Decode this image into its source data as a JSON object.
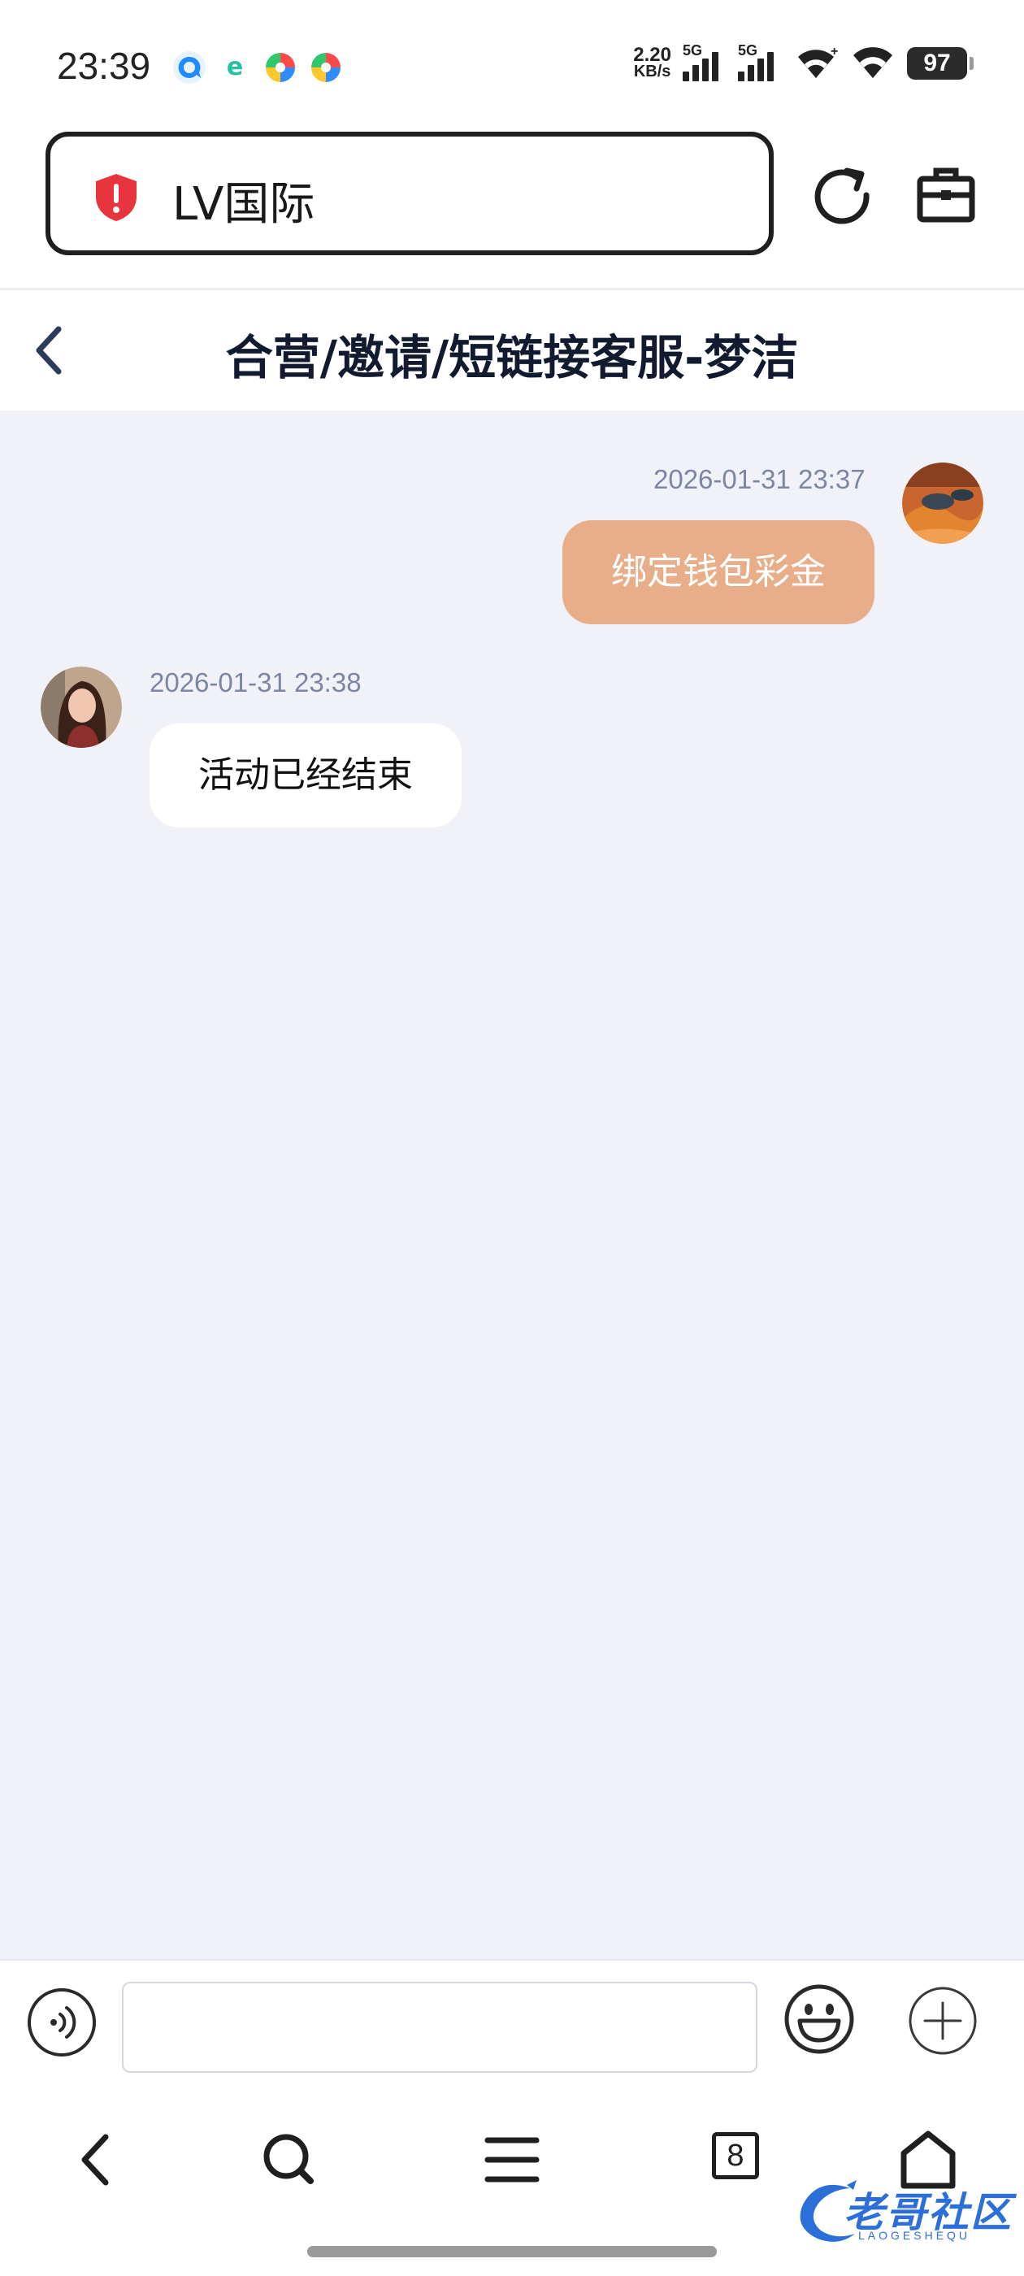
{
  "status_bar": {
    "time": "23:39",
    "net_speed_value": "2.20",
    "net_speed_unit": "KB/s",
    "signal_1_label": "5G",
    "signal_2_label": "5G",
    "battery": "97",
    "notification_icons": [
      "qq-browser-icon",
      "edge-browser-icon",
      "app-icon",
      "app-icon"
    ]
  },
  "browser": {
    "url_text": "LV国际",
    "tab_count": "8"
  },
  "chat": {
    "title": "合营/邀请/短链接客服-梦洁",
    "messages": [
      {
        "direction": "outgoing",
        "timestamp": "2026-01-31 23:37",
        "text": "绑定钱包彩金"
      },
      {
        "direction": "incoming",
        "timestamp": "2026-01-31 23:38",
        "text": "活动已经结束"
      }
    ],
    "input": {
      "value": "",
      "placeholder": ""
    }
  },
  "watermark": {
    "main": "老哥社区",
    "sub": "LAOGESHEQU"
  },
  "colors": {
    "chat_background": "#f1f1f8",
    "outgoing_bubble": "#e8ae8a",
    "incoming_bubble": "#ffffff",
    "timestamp": "#7c86a2",
    "shield": "#e8343c"
  }
}
